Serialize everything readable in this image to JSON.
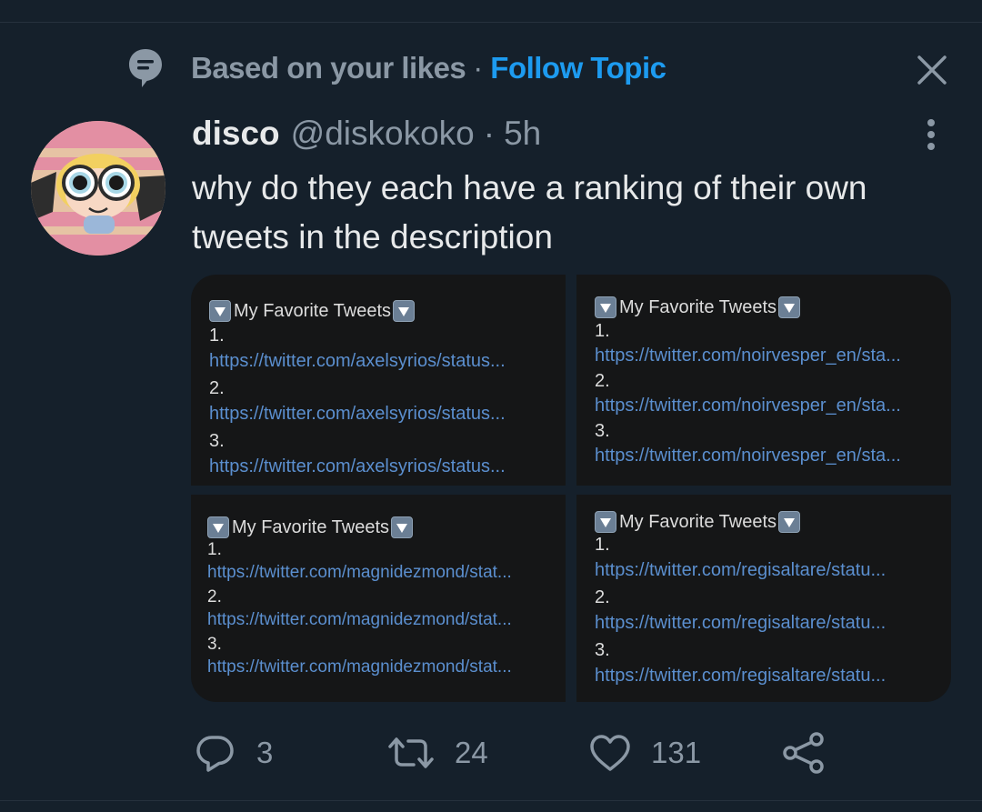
{
  "context": {
    "icon": "topic-icon",
    "label": "Based on your likes",
    "separator": "·",
    "follow_label": "Follow Topic"
  },
  "tweet": {
    "display_name": "disco",
    "handle": "@diskokoko",
    "separator": "·",
    "time": "5h",
    "text": "why do they each have a ranking of their own tweets in the description"
  },
  "media": {
    "cells": [
      {
        "title": "My Favorite Tweets",
        "items": [
          {
            "num": "1.",
            "url": "https://twitter.com/axelsyrios/status..."
          },
          {
            "num": "2.",
            "url": "https://twitter.com/axelsyrios/status..."
          },
          {
            "num": "3.",
            "url": "https://twitter.com/axelsyrios/status..."
          }
        ]
      },
      {
        "title": "My Favorite Tweets",
        "items": [
          {
            "num": "1.",
            "url": "https://twitter.com/noirvesper_en/sta..."
          },
          {
            "num": "2.",
            "url": "https://twitter.com/noirvesper_en/sta..."
          },
          {
            "num": "3.",
            "url": "https://twitter.com/noirvesper_en/sta..."
          }
        ]
      },
      {
        "title": "My Favorite Tweets",
        "items": [
          {
            "num": "1.",
            "url": "https://twitter.com/magnidezmond/stat..."
          },
          {
            "num": "2.",
            "url": "https://twitter.com/magnidezmond/stat..."
          },
          {
            "num": "3.",
            "url": "https://twitter.com/magnidezmond/stat..."
          }
        ]
      },
      {
        "title": "My Favorite Tweets",
        "items": [
          {
            "num": "1.",
            "url": "https://twitter.com/regisaltare/statu..."
          },
          {
            "num": "2.",
            "url": "https://twitter.com/regisaltare/statu..."
          },
          {
            "num": "3.",
            "url": "https://twitter.com/regisaltare/statu..."
          }
        ]
      }
    ]
  },
  "actions": {
    "reply_count": "3",
    "retweet_count": "24",
    "like_count": "131"
  },
  "colors": {
    "background": "#15202b",
    "accent": "#1d9bf0",
    "secondary_text": "#8b98a5",
    "primary_text": "#e7e9ea",
    "link": "#5b8fcf"
  }
}
